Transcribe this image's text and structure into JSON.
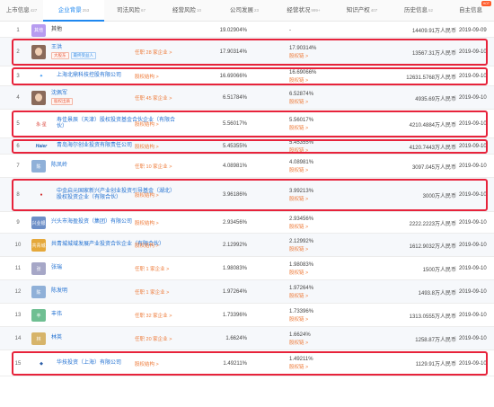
{
  "tabs": [
    {
      "label": "上市信息",
      "count": "427"
    },
    {
      "label": "企业背景",
      "count": "253",
      "active": true
    },
    {
      "label": "司法风险",
      "count": "67"
    },
    {
      "label": "经营风险",
      "count": "10"
    },
    {
      "label": "公司发展",
      "count": "23"
    },
    {
      "label": "经营状况",
      "count": "999+"
    },
    {
      "label": "知识产权",
      "count": "407"
    },
    {
      "label": "历史信息",
      "count": "52"
    },
    {
      "label": "自主信息",
      "hot": "HOT"
    }
  ],
  "rows": [
    {
      "index": "1",
      "avatar_text": "其他",
      "avatar_color": "#b79cf0",
      "name": "其他",
      "pct": "19.02904%",
      "stake": "-",
      "capital": "14409.91万人民币",
      "date": "2019-09-09"
    },
    {
      "index": "2",
      "photo": true,
      "name": "王洪",
      "tags": [
        {
          "text": "大股东",
          "type": "red"
        },
        {
          "text": "最终受益人",
          "type": "blue"
        }
      ],
      "link": "任职 28 家企业 >",
      "pct": "17.90314%",
      "stake": "17.90314%",
      "stake_link": "股权链 >",
      "capital": "13567.31万人民币",
      "date": "2019-09-10"
    },
    {
      "index": "3",
      "logo": "✦",
      "logo_color": "#1f88f0",
      "name": "上海北鼎科技控股有限公司",
      "link": "股权结构 >",
      "pct": "16.69066%",
      "stake": "16.69066%",
      "stake_link": "股权链 >",
      "capital": "12631.5768万人民币",
      "date": "2019-09-10"
    },
    {
      "index": "4",
      "photo": true,
      "name": "沈佩军",
      "tags": [
        {
          "text": "股权出质",
          "type": "red"
        }
      ],
      "link": "任职 45 家企业 >",
      "pct": "6.51784%",
      "stake": "6.52874%",
      "stake_link": "股权链 >",
      "capital": "4935.69万人民币",
      "date": "2019-09-10"
    },
    {
      "index": "5",
      "logo": "永·星",
      "logo_color": "#d93a2f",
      "name": "寿佳景辰（天津）股权投资基金合伙企业（有限合伙）",
      "link": "股权结构 >",
      "pct": "5.56017%",
      "stake": "5.56017%",
      "stake_link": "股权链 >",
      "capital": "4210.4884万人民币",
      "date": "2019-09-10"
    },
    {
      "index": "6",
      "logo": "Haier",
      "logo_color": "#1a5fb4",
      "name": "青岛海尔创业投资有限责任公司",
      "link": "股权结构 >",
      "pct": "5.45355%",
      "stake": "5.45355%",
      "stake_link": "股权链 >",
      "capital": "4120.7443万人民币",
      "date": "2019-09-10"
    },
    {
      "index": "7",
      "avatar_text": "陈",
      "avatar_color": "#8fb0d8",
      "name": "陈凤岭",
      "link": "任职 10 家企业 >",
      "pct": "4.08981%",
      "stake": "4.08981%",
      "stake_link": "股权链 >",
      "capital": "3097.045万人民币",
      "date": "2019-09-10"
    },
    {
      "index": "8",
      "logo": "●",
      "logo_color": "#d32f2f",
      "name": "中金启元国家新兴产业创业投资引导基金（湖北）股权投资企业（有限合伙）",
      "link": "股权结构 >",
      "pct": "3.96186%",
      "stake": "3.99213%",
      "stake_link": "股权链 >",
      "capital": "3000万人民币",
      "date": "2019-09-10"
    },
    {
      "index": "9",
      "avatar_text": "兴业银",
      "avatar_color": "#6d8fc7",
      "name": "兴头市海盈投资（集团）有限公司",
      "link": "股权结构 >",
      "pct": "2.93456%",
      "stake": "2.93456%",
      "stake_link": "股权链 >",
      "capital": "2222.2223万人民币",
      "date": "2019-09-10"
    },
    {
      "index": "10",
      "avatar_text": "共青城",
      "avatar_color": "#e5a83a",
      "name": "共青城城域发展产业投资合伙企业（有限合伙）",
      "link": "股权结构 >",
      "pct": "2.12992%",
      "stake": "2.12992%",
      "stake_link": "股权链 >",
      "capital": "1612.9032万人民币",
      "date": "2019-09-10"
    },
    {
      "index": "11",
      "avatar_text": "张",
      "avatar_color": "#a6a7c7",
      "name": "张瑞",
      "link": "任职 1 家企业 >",
      "pct": "1.98083%",
      "stake": "1.98083%",
      "stake_link": "股权链 >",
      "capital": "1500万人民币",
      "date": "2019-09-10"
    },
    {
      "index": "12",
      "avatar_text": "陈",
      "avatar_color": "#8fb0d8",
      "name": "陈发明",
      "link": "任职 1 家企业 >",
      "pct": "1.97264%",
      "stake": "1.97264%",
      "stake_link": "股权链 >",
      "capital": "1493.8万人民币",
      "date": "2019-09-10"
    },
    {
      "index": "13",
      "avatar_text": "丰",
      "avatar_color": "#6fbf92",
      "name": "丰伟",
      "link": "任职 32 家企业 >",
      "pct": "1.73396%",
      "stake": "1.73396%",
      "stake_link": "股权链 >",
      "capital": "1313.0555万人民币",
      "date": "2019-09-10"
    },
    {
      "index": "14",
      "avatar_text": "林",
      "avatar_color": "#d7b46a",
      "name": "林英",
      "link": "任职 20 家企业 >",
      "pct": "1.6624%",
      "stake": "1.6624%",
      "stake_link": "股权链 >",
      "capital": "1258.87万人民币",
      "date": "2019-09-10"
    },
    {
      "index": "15",
      "logo": "◆",
      "logo_color": "#2b5ea8",
      "name": "华技投资（上海）有限公司",
      "link": "股权结构 >",
      "pct": "1.49211%",
      "stake": "1.49211%",
      "stake_link": "股权链 >",
      "capital": "1129.91万人民币",
      "date": "2019-09-10"
    }
  ]
}
